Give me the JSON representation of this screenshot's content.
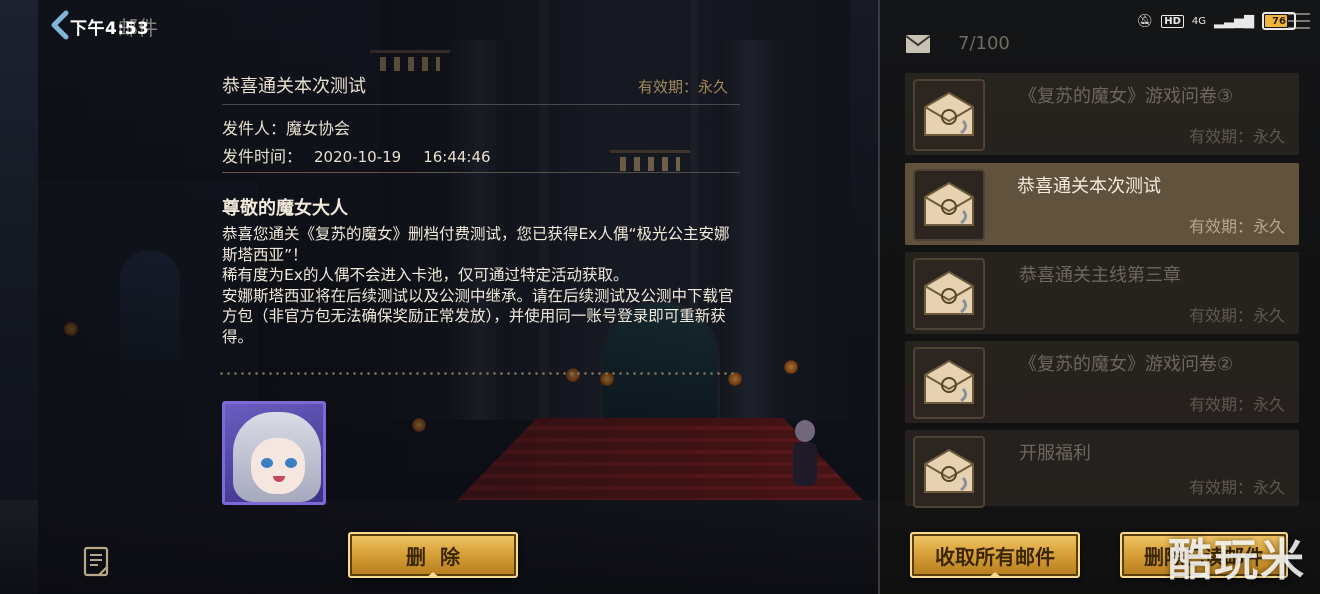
{
  "status_bar": {
    "time": "下午4:53",
    "hd_label": "HD",
    "network": "4G",
    "battery": "76"
  },
  "header": {
    "title": "邮件"
  },
  "detail": {
    "subject": "恭喜通关本次测试",
    "validity_label": "有效期：",
    "validity_value": "永久",
    "sender_label": "发件人：",
    "sender": "魔女协会",
    "time_label": "发件时间：",
    "date": "2020-10-19",
    "time": "16:44:46",
    "greeting": "尊敬的魔女大人",
    "body": "恭喜您通关《复苏的魔女》删档付费测试，您已获得Ex人偶“极光公主安娜斯塔西亚”！\n稀有度为Ex的人偶不会进入卡池，仅可通过特定活动获取。\n安娜斯塔西亚将在后续测试以及公测中继承。请在后续测试及公测中下载官方包（非官方包无法确保奖励正常发放），并使用同一账号登录即可重新获得。",
    "delete_label": "删除"
  },
  "list": {
    "count": "7/100",
    "items": [
      {
        "title": "《复苏的魔女》游戏问卷③",
        "validity": "有效期：永久",
        "selected": false
      },
      {
        "title": "恭喜通关本次测试",
        "validity": "有效期：永久",
        "selected": true
      },
      {
        "title": "恭喜通关主线第三章",
        "validity": "有效期：永久",
        "selected": false
      },
      {
        "title": "《复苏的魔女》游戏问卷②",
        "validity": "有效期：永久",
        "selected": false
      },
      {
        "title": "开服福利",
        "validity": "有效期：永久",
        "selected": false
      }
    ],
    "collect_all_label": "收取所有邮件",
    "delete_read_label": "删除已读邮件"
  },
  "watermark": "酷玩米",
  "colors": {
    "gold_button": "#d9a23a",
    "selected_item": "#967d5a",
    "text_light": "#f1e9da",
    "text_dim": "#6e665c"
  },
  "icons": {
    "back": "back-arrow-icon",
    "mail": "envelope-icon",
    "mail_item": "letter-with-clip-icon",
    "note": "note-icon"
  }
}
